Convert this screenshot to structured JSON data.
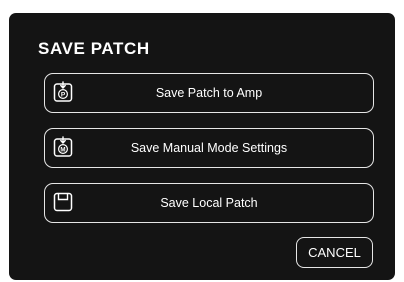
{
  "dialog": {
    "title": "SAVE PATCH",
    "options": [
      {
        "label": "Save Patch to Amp",
        "icon": "amp-patch-icon",
        "badge": "P"
      },
      {
        "label": "Save Manual Mode Settings",
        "icon": "manual-mode-icon",
        "badge": "M"
      },
      {
        "label": "Save Local Patch",
        "icon": "floppy-disk-icon"
      }
    ],
    "cancel_label": "CANCEL"
  },
  "colors": {
    "background": "#141414",
    "foreground": "#ffffff",
    "border": "#e6e6e6"
  }
}
